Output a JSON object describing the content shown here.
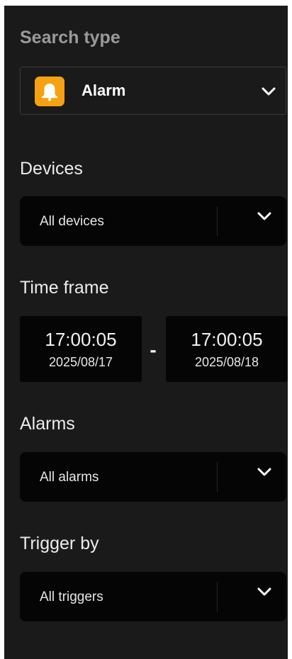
{
  "search_type": {
    "title": "Search type",
    "selected": "Alarm",
    "icon": "bell-icon",
    "icon_color": "#f5a112"
  },
  "devices": {
    "title": "Devices",
    "value": "All devices",
    "icon": "chevron-down-icon"
  },
  "time_frame": {
    "title": "Time frame",
    "start": {
      "time": "17:00:05",
      "date": "2025/08/17"
    },
    "separator": "-",
    "end": {
      "time": "17:00:05",
      "date": "2025/08/18"
    }
  },
  "alarms": {
    "title": "Alarms",
    "value": "All alarms",
    "icon": "chevron-down-icon"
  },
  "trigger_by": {
    "title": "Trigger by",
    "value": "All triggers",
    "icon": "chevron-down-icon"
  },
  "colors": {
    "panel_background": "#1a1a1a",
    "field_background": "#050505",
    "accent": "#f5a112"
  }
}
